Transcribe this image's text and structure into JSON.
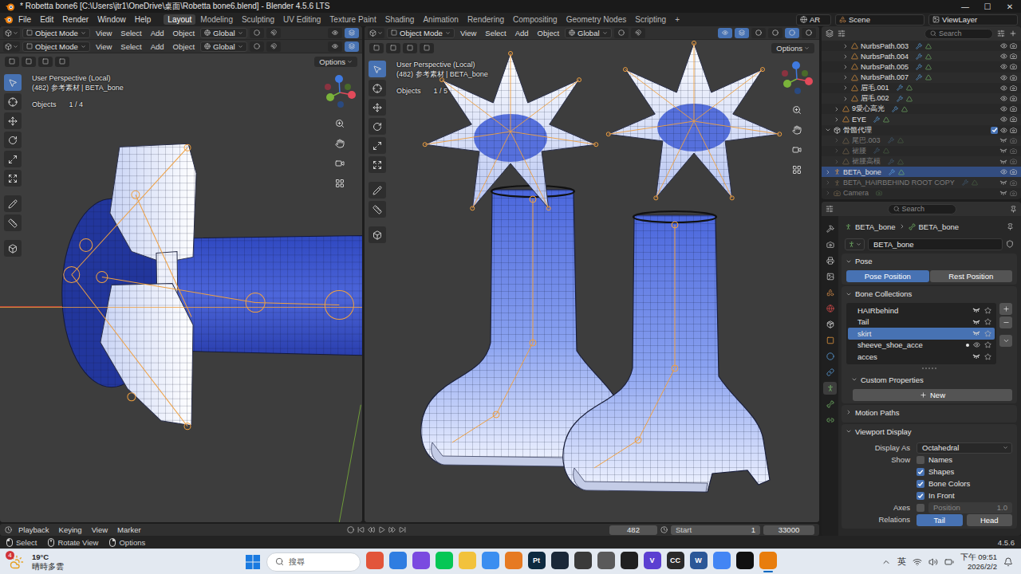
{
  "window": {
    "title": "* Robetta bone6 [C:\\Users\\jtr1\\OneDrive\\桌面\\Robetta bone6.blend] - Blender 4.5.6 LTS",
    "controls": [
      "—",
      "☐",
      "✕"
    ]
  },
  "menu": [
    "File",
    "Edit",
    "Render",
    "Window",
    "Help"
  ],
  "workspaces": [
    {
      "label": "Layout",
      "selected": true
    },
    {
      "label": "Modeling",
      "selected": false
    },
    {
      "label": "Sculpting",
      "selected": false
    },
    {
      "label": "UV Editing",
      "selected": false
    },
    {
      "label": "Texture Paint",
      "selected": false
    },
    {
      "label": "Shading",
      "selected": false
    },
    {
      "label": "Animation",
      "selected": false
    },
    {
      "label": "Rendering",
      "selected": false
    },
    {
      "label": "Compositing",
      "selected": false
    },
    {
      "label": "Geometry Nodes",
      "selected": false
    },
    {
      "label": "Scripting",
      "selected": false
    }
  ],
  "add_workspace": "+",
  "header_right": {
    "language": "AR",
    "scene": "Scene",
    "view_layer": "ViewLayer"
  },
  "viewports": [
    {
      "scene": "side",
      "headers": [
        {
          "mode": "Object Mode",
          "menus": [
            "View",
            "Select",
            "Add",
            "Object"
          ],
          "orientation": "Global",
          "toggles": [
            {
              "selected": false
            },
            {
              "selected": true
            }
          ],
          "shading": []
        },
        {
          "mode": "Object Mode",
          "menus": [
            "View",
            "Select",
            "Add",
            "Object"
          ],
          "orientation": "Global",
          "toggles": [
            {
              "selected": false
            },
            {
              "selected": true
            }
          ],
          "shading": []
        }
      ],
      "options": "Options",
      "perspective": "User Perspective (Local)",
      "context": "(482) 参考素材 | BETA_bone",
      "objects_label": "Objects",
      "objects_count": "1 / 4",
      "tools": [
        {
          "kind": "select",
          "selected": true
        },
        {
          "kind": "cursor",
          "selected": false
        },
        {
          "kind": "move",
          "selected": false
        },
        {
          "kind": "rotate",
          "selected": false
        },
        {
          "kind": "scale",
          "selected": false
        },
        {
          "kind": "transform",
          "selected": false
        },
        {
          "kind": "annotate",
          "selected": false
        },
        {
          "kind": "measure",
          "selected": false
        },
        {
          "kind": "add_cube",
          "selected": false
        }
      ]
    },
    {
      "scene": "boots",
      "headers": [
        {
          "mode": "Object Mode",
          "menus": [
            "View",
            "Select",
            "Add",
            "Object"
          ],
          "orientation": "Global",
          "toggles": [
            {
              "selected": true
            },
            {
              "selected": true
            }
          ],
          "shading": [
            {
              "selected": false
            },
            {
              "selected": false
            },
            {
              "selected": true
            },
            {
              "selected": false
            }
          ]
        }
      ],
      "options": "Options",
      "perspective": "User Perspective (Local)",
      "context": "(482) 参考素材 | BETA_bone",
      "objects_label": "Objects",
      "objects_count": "1 / 5",
      "tools": [
        {
          "kind": "select",
          "selected": true
        },
        {
          "kind": "cursor",
          "selected": false
        },
        {
          "kind": "move",
          "selected": false
        },
        {
          "kind": "rotate",
          "selected": false
        },
        {
          "kind": "scale",
          "selected": false
        },
        {
          "kind": "transform",
          "selected": false
        },
        {
          "kind": "annotate",
          "selected": false
        },
        {
          "kind": "measure",
          "selected": false
        },
        {
          "kind": "add_cube",
          "selected": false
        }
      ]
    }
  ],
  "outliner": {
    "search": "Search",
    "items": [
      {
        "label": "NurbsPath.003",
        "kind": "object",
        "depth": 2,
        "expanded": false,
        "hidden": false,
        "selected": false,
        "checked": false
      },
      {
        "label": "NurbsPath.004",
        "kind": "object",
        "depth": 2,
        "expanded": false,
        "hidden": false,
        "selected": false,
        "checked": false
      },
      {
        "label": "NurbsPath.005",
        "kind": "object",
        "depth": 2,
        "expanded": false,
        "hidden": false,
        "selected": false,
        "checked": false
      },
      {
        "label": "NurbsPath.007",
        "kind": "object",
        "depth": 2,
        "expanded": false,
        "hidden": false,
        "selected": false,
        "checked": false
      },
      {
        "label": "眉毛.001",
        "kind": "object",
        "depth": 2,
        "expanded": false,
        "hidden": false,
        "selected": false,
        "checked": false
      },
      {
        "label": "眉毛.002",
        "kind": "object",
        "depth": 2,
        "expanded": false,
        "hidden": false,
        "selected": false,
        "checked": false
      },
      {
        "label": "9愛心高光",
        "kind": "object",
        "depth": 1,
        "expanded": false,
        "hidden": false,
        "selected": false,
        "checked": false
      },
      {
        "label": "EYE",
        "kind": "object",
        "depth": 1,
        "expanded": false,
        "hidden": false,
        "selected": false,
        "checked": false
      },
      {
        "label": "骨骼代理",
        "kind": "collection",
        "depth": 0,
        "expanded": true,
        "hidden": false,
        "selected": false,
        "checked": true
      },
      {
        "label": "尾巴.003",
        "kind": "object",
        "depth": 1,
        "expanded": false,
        "hidden": true,
        "selected": false,
        "checked": false
      },
      {
        "label": "裙腰",
        "kind": "object",
        "depth": 1,
        "expanded": false,
        "hidden": true,
        "selected": false,
        "checked": false
      },
      {
        "label": "裙腰高模",
        "kind": "object",
        "depth": 1,
        "expanded": false,
        "hidden": true,
        "selected": false,
        "checked": false
      },
      {
        "label": "BETA_bone",
        "kind": "armature",
        "depth": 0,
        "expanded": false,
        "hidden": false,
        "selected": true,
        "checked": false
      },
      {
        "label": "BETA_HAIRBEHIND ROOT COPY",
        "kind": "armature",
        "depth": 0,
        "expanded": false,
        "hidden": true,
        "selected": false,
        "checked": false
      },
      {
        "label": "Camera",
        "kind": "camera",
        "depth": 0,
        "expanded": false,
        "hidden": true,
        "selected": false,
        "checked": false
      }
    ]
  },
  "properties": {
    "search": "Search",
    "breadcrumb": [
      "BETA_bone",
      "BETA_bone"
    ],
    "name": "BETA_bone",
    "tabs": [
      {
        "kind": "tool",
        "selected": false
      },
      {
        "kind": "render",
        "selected": false
      },
      {
        "kind": "output",
        "selected": false
      },
      {
        "kind": "view_layer",
        "selected": false
      },
      {
        "kind": "scene",
        "selected": false
      },
      {
        "kind": "world",
        "selected": false
      },
      {
        "kind": "collection",
        "selected": false
      },
      {
        "kind": "object",
        "selected": false
      },
      {
        "kind": "physics",
        "selected": false
      },
      {
        "kind": "constraints",
        "selected": false
      },
      {
        "kind": "data",
        "selected": true
      },
      {
        "kind": "bone",
        "selected": false
      },
      {
        "kind": "bone_constraints",
        "selected": false
      }
    ],
    "pose": {
      "title": "Pose",
      "expanded": true,
      "positions": [
        {
          "label": "Pose Position",
          "selected": true
        },
        {
          "label": "Rest Position",
          "selected": false
        }
      ]
    },
    "bone_collections": {
      "title": "Bone Collections",
      "expanded": true,
      "items": [
        {
          "label": "HAIRbehind",
          "selected": false,
          "visible": false,
          "has_selected": false,
          "solo": false
        },
        {
          "label": "Tail",
          "selected": false,
          "visible": false,
          "has_selected": false,
          "solo": false
        },
        {
          "label": "skirt",
          "selected": true,
          "visible": false,
          "has_selected": false,
          "solo": false
        },
        {
          "label": "sheeve_shoe_acce",
          "selected": false,
          "visible": true,
          "has_selected": true,
          "solo": false
        },
        {
          "label": "acces",
          "selected": false,
          "visible": false,
          "has_selected": false,
          "solo": false
        }
      ]
    },
    "custom_properties": {
      "title": "Custom Properties",
      "expanded": true,
      "button": "New"
    },
    "motion_paths": {
      "title": "Motion Paths",
      "expanded": false
    },
    "viewport_display": {
      "title": "Viewport Display",
      "expanded": true,
      "display_as_label": "Display As",
      "display_as": "Octahedral",
      "show_label": "Show",
      "show": [
        {
          "label": "Names",
          "checked": false
        },
        {
          "label": "Shapes",
          "checked": true
        },
        {
          "label": "Bone Colors",
          "checked": true
        },
        {
          "label": "In Front",
          "checked": true
        }
      ],
      "axes_label": "Axes",
      "axes": {
        "checked": false,
        "field_label": "Position",
        "field_value": "1.0",
        "disabled": true
      },
      "relations_label": "Relations",
      "relations": [
        {
          "label": "Tail",
          "selected": true
        },
        {
          "label": "Head",
          "selected": false
        }
      ]
    }
  },
  "timeline": {
    "menus": [
      "Playback",
      "Keying",
      "View",
      "Marker"
    ],
    "frame": "482",
    "start_label": "Start",
    "start": "1",
    "end": "33000"
  },
  "status_bar": {
    "hints": [
      {
        "label": "Select",
        "kind": "left"
      },
      {
        "label": "Rotate View",
        "kind": "middle"
      },
      {
        "label": "Options",
        "kind": "right"
      }
    ],
    "version": "4.5.6"
  },
  "taskbar": {
    "weather": {
      "badge": "4",
      "temp": "19°C",
      "desc": "晴時多雲"
    },
    "search": "搜尋",
    "apps": [
      {
        "color": "#e2553a",
        "active": false
      },
      {
        "color": "#2f7de1",
        "active": false
      },
      {
        "color": "#7a4ae0",
        "active": false
      },
      {
        "color": "#06c755",
        "active": false
      },
      {
        "color": "#f2c23c",
        "active": false
      },
      {
        "color": "#3b8ef0",
        "active": false
      },
      {
        "color": "#e67a22",
        "active": false
      },
      {
        "glyph": "Pt",
        "color": "#0d2a40",
        "active": false
      },
      {
        "color": "#1b2838",
        "active": false
      },
      {
        "color": "#3a3a3a",
        "active": false
      },
      {
        "color": "#5a5a5a",
        "active": false
      },
      {
        "color": "#202020",
        "active": false
      },
      {
        "glyph": "V",
        "color": "#5b3fd1",
        "active": false
      },
      {
        "glyph": "CC",
        "color": "#2a2a2a",
        "active": false
      },
      {
        "glyph": "W",
        "color": "#2b5797",
        "active": false
      },
      {
        "color": "#4285f4",
        "active": false
      },
      {
        "color": "#101010",
        "active": false
      },
      {
        "color": "#e87d0d",
        "active": true
      }
    ],
    "tray": {
      "language": "英",
      "time": "下午 09:51",
      "date": "2026/2/2"
    }
  }
}
